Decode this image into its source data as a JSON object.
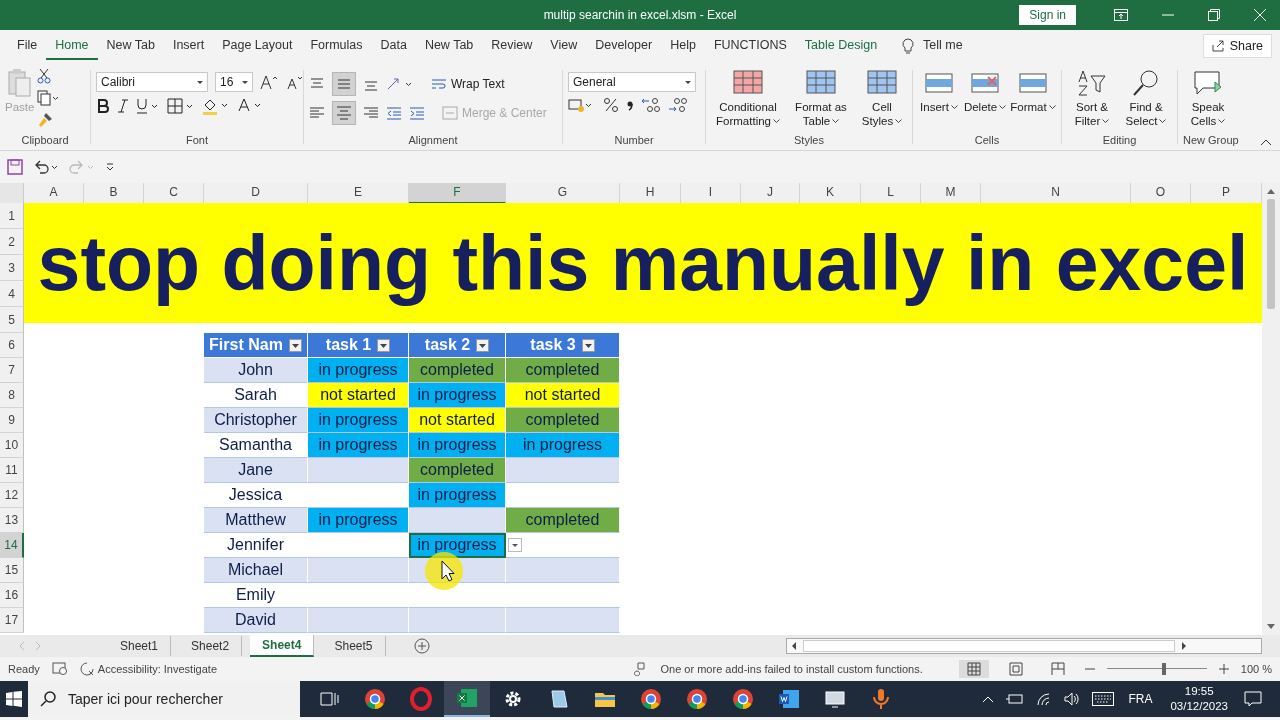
{
  "window": {
    "title": "multip searchin in excel.xlsm  -  Excel",
    "sign_in": "Sign in"
  },
  "ribbon_tabs": [
    {
      "label": "File",
      "selected": false,
      "kind": "normal"
    },
    {
      "label": "Home",
      "selected": true,
      "kind": "normal"
    },
    {
      "label": "New Tab",
      "selected": false,
      "kind": "normal"
    },
    {
      "label": "Insert",
      "selected": false,
      "kind": "normal"
    },
    {
      "label": "Page Layout",
      "selected": false,
      "kind": "normal"
    },
    {
      "label": "Formulas",
      "selected": false,
      "kind": "normal"
    },
    {
      "label": "Data",
      "selected": false,
      "kind": "normal"
    },
    {
      "label": "New Tab",
      "selected": false,
      "kind": "normal"
    },
    {
      "label": "Review",
      "selected": false,
      "kind": "normal"
    },
    {
      "label": "View",
      "selected": false,
      "kind": "normal"
    },
    {
      "label": "Developer",
      "selected": false,
      "kind": "normal"
    },
    {
      "label": "Help",
      "selected": false,
      "kind": "normal"
    },
    {
      "label": "FUNCTIONS",
      "selected": false,
      "kind": "normal"
    },
    {
      "label": "Table Design",
      "selected": false,
      "kind": "contextual"
    }
  ],
  "tell_me": "Tell me",
  "share": "Share",
  "ribbon": {
    "clipboard": {
      "label": "Clipboard",
      "paste": {
        "label": "Paste",
        "disabled": true
      }
    },
    "font": {
      "label": "Font",
      "name": "Calibri",
      "size": "16"
    },
    "alignment": {
      "label": "Alignment",
      "wrap_text": "Wrap Text",
      "merge_center": {
        "label": "Merge & Center",
        "disabled": true
      }
    },
    "number": {
      "label": "Number",
      "format": "General"
    },
    "styles": {
      "label": "Styles",
      "buttons": [
        "Conditional Formatting",
        "Format as Table",
        "Cell Styles"
      ]
    },
    "cells": {
      "label": "Cells",
      "buttons": [
        "Insert",
        "Delete",
        "Format"
      ]
    },
    "editing": {
      "label": "Editing",
      "buttons": [
        "Sort & Filter",
        "Find & Select"
      ]
    },
    "new_group": {
      "label": "New Group",
      "buttons": [
        "Speak Cells"
      ]
    }
  },
  "columns": [
    {
      "label": "A",
      "selected": false
    },
    {
      "label": "B",
      "selected": false
    },
    {
      "label": "C",
      "selected": false
    },
    {
      "label": "D",
      "selected": false
    },
    {
      "label": "E",
      "selected": false
    },
    {
      "label": "F",
      "selected": true
    },
    {
      "label": "G",
      "selected": false
    },
    {
      "label": "H",
      "selected": false
    },
    {
      "label": "I",
      "selected": false
    },
    {
      "label": "J",
      "selected": false
    },
    {
      "label": "K",
      "selected": false
    },
    {
      "label": "L",
      "selected": false
    },
    {
      "label": "M",
      "selected": false
    },
    {
      "label": "N",
      "selected": false
    },
    {
      "label": "O",
      "selected": false
    },
    {
      "label": "P",
      "selected": false
    }
  ],
  "banner": {
    "rows": [
      "1",
      "2",
      "3",
      "4",
      "5"
    ],
    "text": "stop doing this manually in excel"
  },
  "table": {
    "header_row": "6",
    "headers": [
      "First Nam",
      "task 1",
      "task 2",
      "task 3"
    ],
    "rows": [
      {
        "row": "7",
        "selected": false,
        "name": "John",
        "tasks": [
          {
            "text": "in progress",
            "color": "#00b0f0",
            "selected": false
          },
          {
            "text": "completed",
            "color": "#70ad47",
            "selected": false
          },
          {
            "text": "completed",
            "color": "#70ad47",
            "selected": false
          }
        ]
      },
      {
        "row": "8",
        "selected": false,
        "name": "Sarah",
        "tasks": [
          {
            "text": "not started",
            "color": "#ffff00",
            "selected": false
          },
          {
            "text": "in progress",
            "color": "#00b0f0",
            "selected": false
          },
          {
            "text": "not started",
            "color": "#ffff00",
            "selected": false
          }
        ]
      },
      {
        "row": "9",
        "selected": false,
        "name": "Christopher",
        "tasks": [
          {
            "text": "in progress",
            "color": "#00b0f0",
            "selected": false
          },
          {
            "text": "not started",
            "color": "#ffff00",
            "selected": false
          },
          {
            "text": "completed",
            "color": "#70ad47",
            "selected": false
          }
        ]
      },
      {
        "row": "10",
        "selected": false,
        "name": "Samantha",
        "tasks": [
          {
            "text": "in progress",
            "color": "#00b0f0",
            "selected": false
          },
          {
            "text": "in progress",
            "color": "#00b0f0",
            "selected": false
          },
          {
            "text": "in progress",
            "color": "#00b0f0",
            "selected": false
          }
        ]
      },
      {
        "row": "11",
        "selected": false,
        "name": "Jane",
        "tasks": [
          {
            "selected": false
          },
          {
            "text": "completed",
            "color": "#70ad47",
            "selected": false
          },
          {
            "selected": false
          }
        ]
      },
      {
        "row": "12",
        "selected": false,
        "name": "Jessica",
        "tasks": [
          {
            "selected": false
          },
          {
            "text": "in progress",
            "color": "#00b0f0",
            "selected": false
          },
          {
            "selected": false
          }
        ]
      },
      {
        "row": "13",
        "selected": false,
        "name": "Matthew",
        "tasks": [
          {
            "text": "in progress",
            "color": "#00b0f0",
            "selected": false
          },
          {
            "selected": false
          },
          {
            "text": "completed",
            "color": "#70ad47",
            "selected": false
          }
        ]
      },
      {
        "row": "14",
        "selected": true,
        "name": "Jennifer",
        "tasks": [
          {
            "selected": false
          },
          {
            "text": "in progress",
            "color": "#00b0f0",
            "selected": true
          },
          {
            "selected": false
          }
        ]
      },
      {
        "row": "15",
        "selected": false,
        "name": "Michael",
        "tasks": [
          {
            "selected": false
          },
          {
            "selected": false
          },
          {
            "selected": false
          }
        ]
      },
      {
        "row": "16",
        "selected": false,
        "name": "Emily",
        "tasks": [
          {
            "selected": false
          },
          {
            "selected": false
          },
          {
            "selected": false
          }
        ]
      },
      {
        "row": "17",
        "selected": false,
        "name": "David",
        "tasks": [
          {
            "selected": false
          },
          {
            "selected": false
          },
          {
            "selected": false
          }
        ]
      }
    ]
  },
  "sheets": [
    {
      "label": "Sheet1",
      "selected": false
    },
    {
      "label": "Sheet2",
      "selected": false
    },
    {
      "label": "Sheet4",
      "selected": true
    },
    {
      "label": "Sheet5",
      "selected": false
    }
  ],
  "status": {
    "ready": "Ready",
    "accessibility": "Accessibility: Investigate",
    "addins": "One or more add-ins failed to install custom functions.",
    "zoom": "100 %",
    "zoom_slider": {
      "level": 0.57
    }
  },
  "taskbar": {
    "placeholder": "Taper ici pour rechercher",
    "apps": [
      {
        "kind": "task-view",
        "active": false
      },
      {
        "kind": "chrome",
        "active": false
      },
      {
        "kind": "opera",
        "active": false
      },
      {
        "kind": "excel",
        "active": true
      },
      {
        "kind": "settings",
        "active": false
      },
      {
        "kind": "notes",
        "active": false
      },
      {
        "kind": "folder",
        "active": false
      },
      {
        "kind": "chrome",
        "active": false
      },
      {
        "kind": "chrome",
        "active": false
      },
      {
        "kind": "chrome",
        "active": false
      },
      {
        "kind": "word",
        "active": false
      },
      {
        "kind": "monitor",
        "active": false
      },
      {
        "kind": "microphone",
        "active": false
      }
    ],
    "language": "FRA",
    "time": "19:55",
    "date": "03/12/2023"
  }
}
